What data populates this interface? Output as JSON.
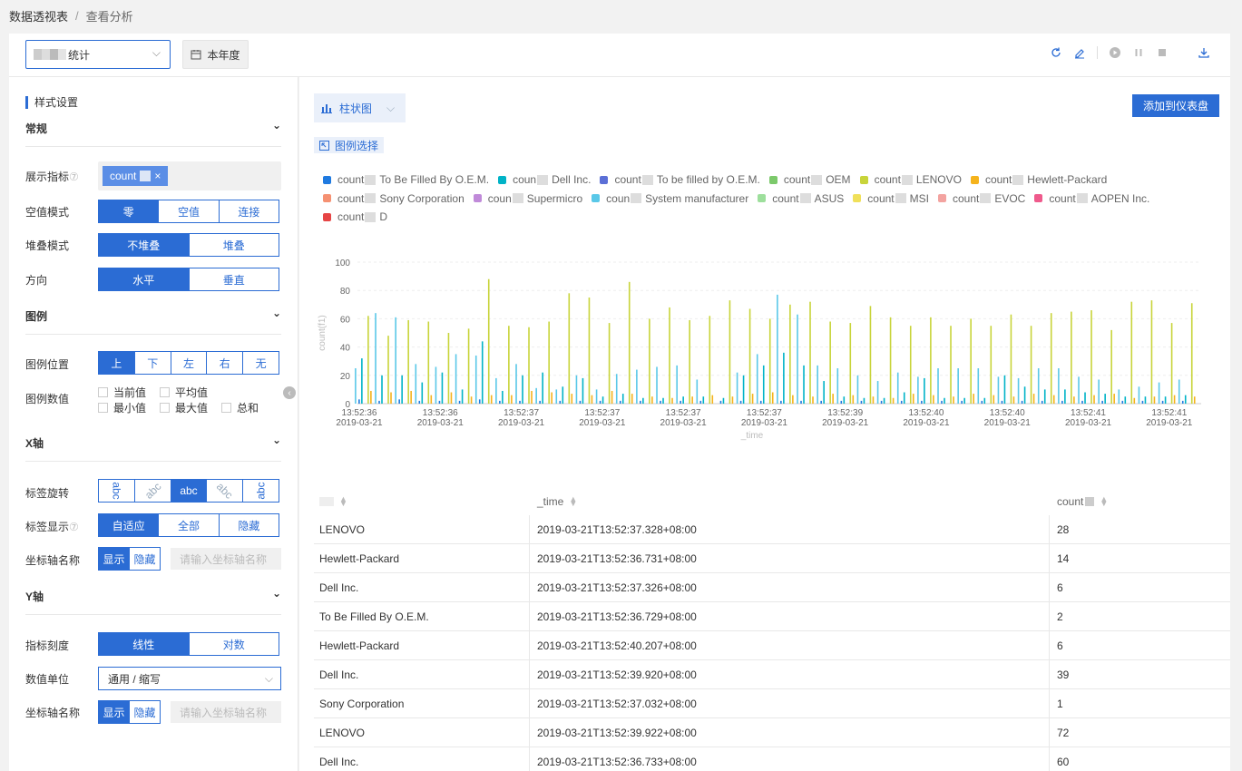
{
  "breadcrumb": {
    "root": "数据透视表",
    "sep": "/",
    "current": "查看分析"
  },
  "topbar": {
    "select_value": "统计",
    "date_label": "本年度"
  },
  "left": {
    "section_title": "样式设置",
    "general": {
      "title": "常规",
      "metric_label": "展示指标",
      "metric_tag": "count",
      "null_label": "空值模式",
      "null_opts": [
        "零",
        "空值",
        "连接"
      ],
      "stack_label": "堆叠模式",
      "stack_opts": [
        "不堆叠",
        "堆叠"
      ],
      "dir_label": "方向",
      "dir_opts": [
        "水平",
        "垂直"
      ]
    },
    "legend": {
      "title": "图例",
      "pos_label": "图例位置",
      "pos_opts": [
        "上",
        "下",
        "左",
        "右",
        "无"
      ],
      "val_label": "图例数值",
      "vals": [
        "当前值",
        "平均值",
        "最小值",
        "最大值",
        "总和"
      ]
    },
    "xaxis": {
      "title": "X轴",
      "rot_label": "标签旋转",
      "rot_opts": [
        "abc",
        "abc",
        "abc",
        "abc",
        "abc"
      ],
      "disp_label": "标签显示",
      "disp_opts": [
        "自适应",
        "全部",
        "隐藏"
      ],
      "name_label": "坐标轴名称",
      "name_opts": [
        "显示",
        "隐藏"
      ],
      "name_ph": "请输入坐标轴名称"
    },
    "yaxis": {
      "title": "Y轴",
      "scale_label": "指标刻度",
      "scale_opts": [
        "线性",
        "对数"
      ],
      "unit_label": "数值单位",
      "unit_value": "通用 / 缩写",
      "name_label": "坐标轴名称",
      "name_opts": [
        "显示",
        "隐藏"
      ],
      "name_ph": "请输入坐标轴名称"
    }
  },
  "right": {
    "chart_type": "柱状图",
    "add_button": "添加到仪表盘",
    "legend_select": "图例选择",
    "legend": [
      {
        "pre": "count",
        "name": "To Be Filled By O.E.M.",
        "color": "#1f7ae0"
      },
      {
        "pre": "coun",
        "name": "Dell Inc.",
        "color": "#00b3c7"
      },
      {
        "pre": "count",
        "name": "To be filled by O.E.M.",
        "color": "#5b6fd6"
      },
      {
        "pre": "count",
        "name": "OEM",
        "color": "#7cc96b"
      },
      {
        "pre": "count",
        "name": "LENOVO",
        "color": "#c8d43a"
      },
      {
        "pre": "count",
        "name": "Hewlett-Packard",
        "color": "#f5b31c"
      },
      {
        "pre": "count",
        "name": "Sony Corporation",
        "color": "#f59172"
      },
      {
        "pre": "coun",
        "name": "Supermicro",
        "color": "#c08ad9"
      },
      {
        "pre": "coun",
        "name": "System manufacturer",
        "color": "#5ac8e8"
      },
      {
        "pre": "count",
        "name": "ASUS",
        "color": "#9ddf9c"
      },
      {
        "pre": "count",
        "name": "MSI",
        "color": "#f0e05a"
      },
      {
        "pre": "count",
        "name": "EVOC",
        "color": "#f3a3a0"
      },
      {
        "pre": "count",
        "name": "AOPEN Inc.",
        "color": "#ef5a8c"
      },
      {
        "pre": "count",
        "name": "D",
        "color": "#e64545"
      }
    ],
    "table": {
      "headers": [
        "",
        "_time",
        "count"
      ],
      "rows": [
        [
          "LENOVO",
          "2019-03-21T13:52:37.328+08:00",
          "28"
        ],
        [
          "Hewlett-Packard",
          "2019-03-21T13:52:36.731+08:00",
          "14"
        ],
        [
          "Dell Inc.",
          "2019-03-21T13:52:37.326+08:00",
          "6"
        ],
        [
          "To Be Filled By O.E.M.",
          "2019-03-21T13:52:36.729+08:00",
          "2"
        ],
        [
          "Hewlett-Packard",
          "2019-03-21T13:52:40.207+08:00",
          "6"
        ],
        [
          "Dell Inc.",
          "2019-03-21T13:52:39.920+08:00",
          "39"
        ],
        [
          "Sony Corporation",
          "2019-03-21T13:52:37.032+08:00",
          "1"
        ],
        [
          "LENOVO",
          "2019-03-21T13:52:39.922+08:00",
          "72"
        ],
        [
          "Dell Inc.",
          "2019-03-21T13:52:36.733+08:00",
          "60"
        ]
      ]
    }
  },
  "chart_data": {
    "type": "bar",
    "ylabel": "count(f1)",
    "xlabel": "_time",
    "ylim": [
      0,
      100
    ],
    "yticks": [
      0,
      20,
      40,
      60,
      80,
      100
    ],
    "xticks": [
      [
        "13:52:36",
        "2019-03-21"
      ],
      [
        "13:52:36",
        "2019-03-21"
      ],
      [
        "13:52:37",
        "2019-03-21"
      ],
      [
        "13:52:37",
        "2019-03-21"
      ],
      [
        "13:52:37",
        "2019-03-21"
      ],
      [
        "13:52:37",
        "2019-03-21"
      ],
      [
        "13:52:39",
        "2019-03-21"
      ],
      [
        "13:52:40",
        "2019-03-21"
      ],
      [
        "13:52:40",
        "2019-03-21"
      ],
      [
        "13:52:41",
        "2019-03-21"
      ],
      [
        "13:52:41",
        "2019-03-21"
      ]
    ],
    "series": [
      {
        "name": "LENOVO",
        "color": "#c8d43a",
        "values": [
          62,
          48,
          59,
          58,
          50,
          53,
          88,
          55,
          54,
          58,
          78,
          75,
          57,
          86,
          60,
          68,
          59,
          62,
          73,
          67,
          60,
          70,
          72,
          58,
          57,
          69,
          61,
          55,
          61,
          55,
          60,
          55,
          63,
          55,
          64,
          65,
          66,
          52,
          72,
          73,
          57,
          71
        ]
      },
      {
        "name": "System manufacturer",
        "color": "#5ac8e8",
        "values": [
          25,
          64,
          61,
          28,
          26,
          35,
          34,
          18,
          28,
          11,
          10,
          20,
          10,
          21,
          24,
          26,
          27,
          17,
          0,
          22,
          35,
          77,
          63,
          27,
          25,
          20,
          16,
          22,
          19,
          25,
          25,
          25,
          19,
          18,
          25,
          25,
          19,
          17,
          10,
          12,
          15,
          17
        ]
      },
      {
        "name": "Dell Inc.",
        "color": "#00b3c7",
        "values": [
          32,
          20,
          20,
          15,
          22,
          10,
          44,
          9,
          20,
          22,
          12,
          18,
          5,
          7,
          4,
          4,
          5,
          5,
          4,
          20,
          27,
          36,
          27,
          16,
          5,
          4,
          4,
          8,
          18,
          4,
          4,
          4,
          20,
          12,
          10,
          10,
          8,
          7,
          5,
          5,
          5,
          6
        ]
      },
      {
        "name": "Hewlett-Packard",
        "color": "#f5b31c",
        "values": [
          9,
          8,
          9,
          6,
          8,
          5,
          6,
          6,
          9,
          8,
          7,
          6,
          9,
          7,
          5,
          4,
          5,
          6,
          5,
          7,
          8,
          6,
          5,
          7,
          6,
          5,
          4,
          7,
          6,
          5,
          7,
          6,
          5,
          7,
          6,
          5,
          6,
          7,
          4,
          5,
          6,
          5
        ]
      },
      {
        "name": "To Be Filled By O.E.M.",
        "color": "#1f7ae0",
        "values": [
          3,
          2,
          3,
          2,
          2,
          2,
          3,
          2,
          2,
          2,
          2,
          2,
          2,
          2,
          2,
          2,
          2,
          2,
          2,
          2,
          2,
          2,
          2,
          2,
          2,
          2,
          2,
          2,
          2,
          2,
          2,
          2,
          2,
          2,
          2,
          2,
          2,
          2,
          2,
          2,
          2,
          2
        ]
      }
    ]
  }
}
